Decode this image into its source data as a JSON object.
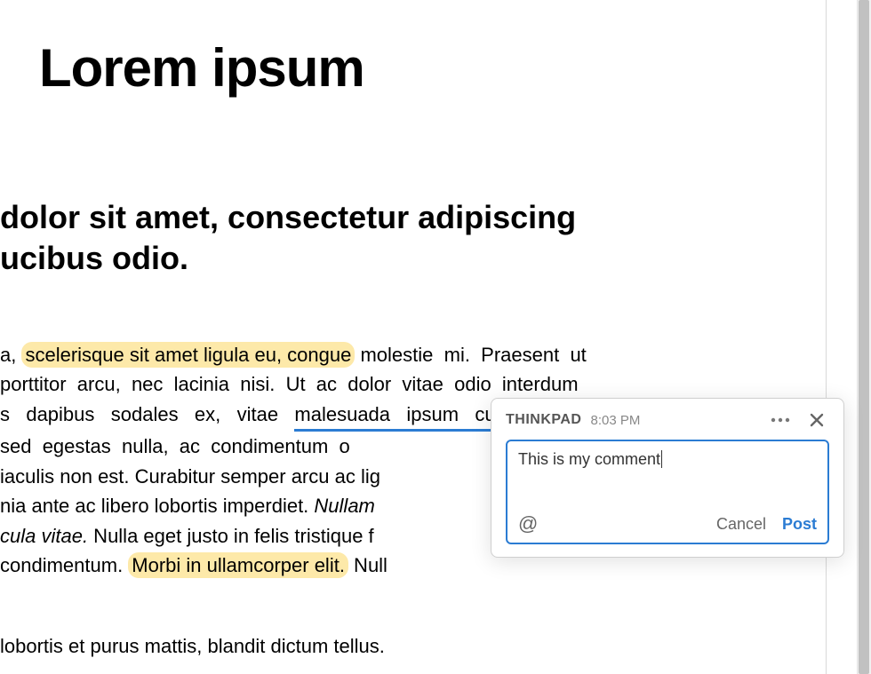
{
  "doc": {
    "title": "Lorem ipsum",
    "heading_line1": " dolor sit amet, consectetur adipiscing",
    "heading_line2": "ucibus odio.",
    "para1": {
      "r1_pre": "a, ",
      "r1_hl": "scelerisque sit amet ligula eu, congue",
      "r1_post": " molestie  mi.  Praesent  ut",
      "r2": "porttitor  arcu,  nec  lacinia  nisi.  Ut  ac  dolor  vitae  odio  interdum",
      "r3_pre": "s   dapibus   sodales   ex,   vitae   ",
      "r3_underlined": "malesuada   ipsum   cursus",
      "r4": "sed  egestas  nulla,  ac  condimentum  o",
      "r5": "iaculis non est. Curabitur semper arcu ac lig",
      "r6_pre": "nia ante ac libero lobortis imperdiet. ",
      "r6_italic": "Nullam ",
      "r7_italic": "cula vitae.",
      "r7_post": " Nulla eget justo in felis tristique f",
      "r8_pre": "condimentum. ",
      "r8_hl": "Morbi in ullamcorper elit.",
      "r8_post": " Null"
    },
    "last_line": " lobortis et purus mattis, blandit dictum tellus."
  },
  "comment": {
    "author": "THINKPAD",
    "time": "8:03 PM",
    "text": "This is my comment",
    "mention_symbol": "@",
    "cancel_label": "Cancel",
    "post_label": "Post"
  }
}
